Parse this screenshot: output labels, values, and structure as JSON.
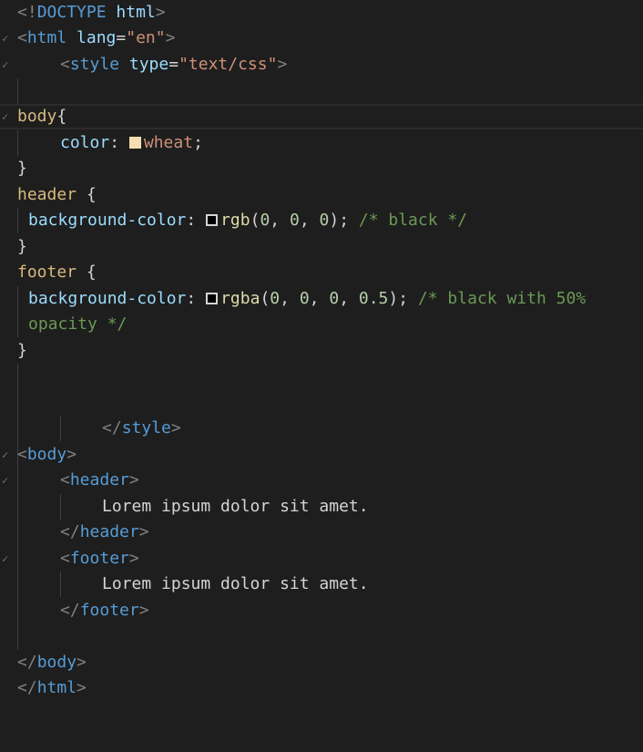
{
  "editor": {
    "theme_colors": {
      "background": "#1e1e1e",
      "tag": "#569cd6",
      "attribute": "#9cdcfe",
      "string": "#ce9178",
      "selector": "#d7ba7d",
      "function": "#dcdcaa",
      "number": "#b5cea8",
      "comment": "#6a9955",
      "punctuation": "#808080"
    },
    "fold_marker": "✓",
    "lines": {
      "l1": {
        "open": "<!",
        "doctype": "DOCTYPE",
        "space": " ",
        "html": "html",
        "close": ">"
      },
      "l2": {
        "open": "<",
        "tag": "html",
        "space": " ",
        "attr": "lang",
        "eq": "=",
        "val": "\"en\"",
        "close": ">"
      },
      "l3": {
        "open": "<",
        "tag": "style",
        "space": " ",
        "attr": "type",
        "eq": "=",
        "val": "\"text/css\"",
        "close": ">"
      },
      "l5": {
        "selector": "body",
        "brace": "{"
      },
      "l6": {
        "prop": "color",
        "colon": ": ",
        "swatch": "wheat",
        "value": "wheat",
        "semi": ";"
      },
      "l7": {
        "brace": "}"
      },
      "l8": {
        "selector": "header",
        "brace": " {"
      },
      "l9": {
        "prop": "background-color",
        "colon": ": ",
        "swatch": "black",
        "fn": "rgb",
        "paren_open": "(",
        "n1": "0",
        "c1": ", ",
        "n2": "0",
        "c2": ", ",
        "n3": "0",
        "paren_close": ")",
        "semi": "; ",
        "comment": "/* black */"
      },
      "l10": {
        "brace": "}"
      },
      "l11": {
        "selector": "footer",
        "brace": " {"
      },
      "l12": {
        "prop": "background-color",
        "colon": ": ",
        "swatch": "black-50",
        "fn": "rgba",
        "paren_open": "(",
        "n1": "0",
        "c1": ", ",
        "n2": "0",
        "c2": ", ",
        "n3": "0",
        "c3": ", ",
        "n4": "0.5",
        "paren_close": ")",
        "semi": "; ",
        "comment": "/* black with 50%"
      },
      "l13": {
        "comment": "opacity */"
      },
      "l14": {
        "brace": "}"
      },
      "l17": {
        "open": "</",
        "tag": "style",
        "close": ">"
      },
      "l18": {
        "open": "<",
        "tag": "body",
        "close": ">"
      },
      "l19": {
        "open": "<",
        "tag": "header",
        "close": ">"
      },
      "l20": {
        "text": "Lorem ipsum dolor sit amet."
      },
      "l21": {
        "open": "</",
        "tag": "header",
        "close": ">"
      },
      "l22": {
        "open": "<",
        "tag": "footer",
        "close": ">"
      },
      "l23": {
        "text": "Lorem ipsum dolor sit amet."
      },
      "l24": {
        "open": "</",
        "tag": "footer",
        "close": ">"
      },
      "l26": {
        "open": "</",
        "tag": "body",
        "close": ">"
      },
      "l27": {
        "open": "</",
        "tag": "html",
        "close": ">"
      }
    }
  }
}
